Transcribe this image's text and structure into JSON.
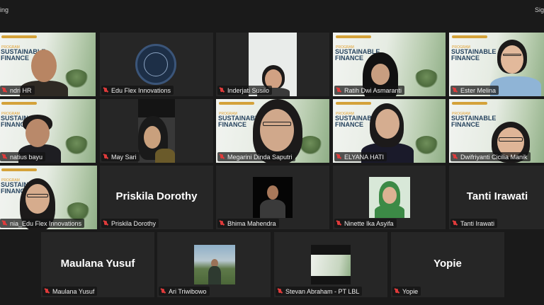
{
  "top": {
    "left_text": "ing",
    "right_text": "Sig"
  },
  "slide": {
    "kicker": "PROGRAM",
    "title_line1": "SUSTAINABLE",
    "title_line2": "FINANCE"
  },
  "participants": [
    {
      "name": "ndri HR",
      "muted": true,
      "video": true
    },
    {
      "name": "Edu Flex Innovations",
      "muted": true,
      "video": true
    },
    {
      "name": "Inderjati Susilo",
      "muted": true,
      "video": true
    },
    {
      "name": "Ratih Dwi Asmaranti",
      "muted": true,
      "video": true
    },
    {
      "name": "Ester Melina",
      "muted": true,
      "video": true
    },
    {
      "name": "natius bayu",
      "muted": true,
      "video": true
    },
    {
      "name": "May Sari",
      "muted": true,
      "video": true
    },
    {
      "name": "Megarini Dinda Saputri",
      "muted": true,
      "video": true
    },
    {
      "name": "ELYANA HATI",
      "muted": true,
      "video": true
    },
    {
      "name": "Dwifriyanti Cicilia Manik",
      "muted": true,
      "video": true
    },
    {
      "name": "nia_Edu Flex Innovations",
      "muted": true,
      "video": true,
      "active_speaker": true
    },
    {
      "name": "Priskila Dorothy",
      "muted": true,
      "video": false
    },
    {
      "name": "Bhima Mahendra",
      "muted": true,
      "video": true
    },
    {
      "name": "Ninette Ika Asyifa",
      "muted": true,
      "video": true
    },
    {
      "name": "Tanti Irawati",
      "muted": true,
      "video": false
    },
    {
      "name": "Maulana Yusuf",
      "muted": true,
      "video": false
    },
    {
      "name": "Ari Triwibowo",
      "muted": true,
      "video": true
    },
    {
      "name": "Stevan Abraham - PT LBL",
      "muted": true,
      "video": true
    },
    {
      "name": "Yopie",
      "muted": true,
      "video": false
    }
  ],
  "colors": {
    "muted_icon": "#e03b3b",
    "active_border": "#9acd32",
    "tile_bg": "#262626"
  }
}
